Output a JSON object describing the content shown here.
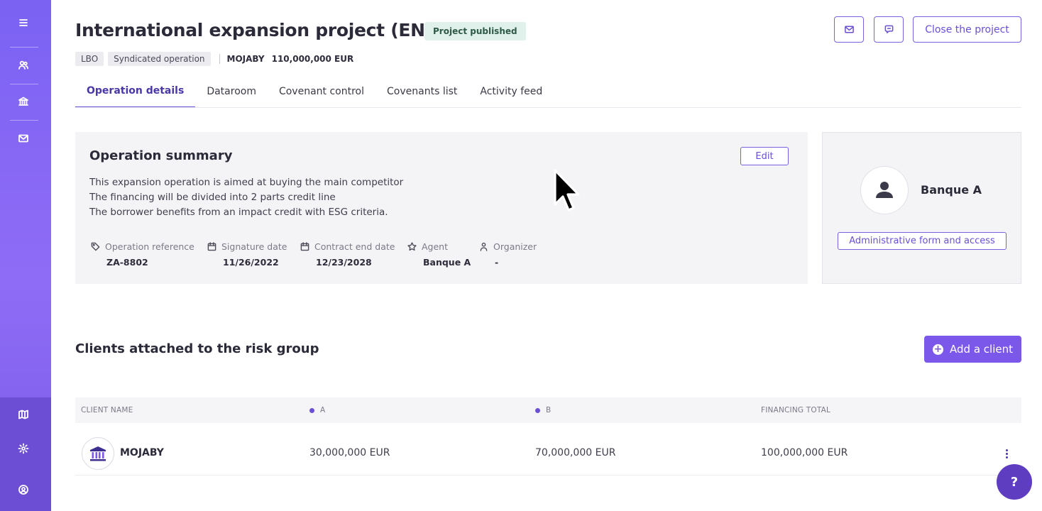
{
  "header": {
    "title": "International expansion project (EN)",
    "status": "Project published",
    "close_label": "Close the project",
    "icon_buttons": [
      "mail-icon",
      "chat-icon"
    ],
    "tags": [
      "LBO",
      "Syndicated operation"
    ],
    "borrower": "MOJABY",
    "amount": "110,000,000 EUR"
  },
  "sidebar": {
    "items": [
      "menu-icon",
      "users-icon",
      "bank-icon",
      "mail-icon"
    ],
    "bottom_items": [
      "map-icon",
      "settings-icon",
      "user-circle-icon"
    ]
  },
  "tabs": [
    {
      "label": "Operation details",
      "active": true
    },
    {
      "label": "Dataroom",
      "active": false
    },
    {
      "label": "Covenant control",
      "active": false
    },
    {
      "label": "Covenants list",
      "active": false
    },
    {
      "label": "Activity feed",
      "active": false
    }
  ],
  "summary": {
    "title": "Operation summary",
    "edit_label": "Edit",
    "lines": [
      "This expansion operation is aimed at buying the main competitor",
      "The financing will be divided into 2 parts credit line",
      "The borrower benefits from an impact credit with ESG criteria."
    ],
    "fields": [
      {
        "label": "Operation reference",
        "value": "ZA-8802",
        "icon": "tag-icon"
      },
      {
        "label": "Signature date",
        "value": "11/26/2022",
        "icon": "calendar-icon"
      },
      {
        "label": "Contract end date",
        "value": "12/23/2028",
        "icon": "calendar-icon"
      },
      {
        "label": "Agent",
        "value": "Banque A",
        "icon": "star-icon"
      },
      {
        "label": "Organizer",
        "value": "-",
        "icon": "person-icon"
      }
    ]
  },
  "agent_card": {
    "name": "Banque A",
    "admin_label": "Administrative form and access"
  },
  "clients": {
    "title": "Clients attached to the risk group",
    "add_label": "Add a client",
    "columns": [
      "CLIENT NAME",
      "A",
      "B",
      "FINANCING TOTAL"
    ],
    "rows": [
      {
        "name": "MOJABY",
        "a": "30,000,000 EUR",
        "b": "70,000,000 EUR",
        "total": "100,000,000 EUR"
      }
    ]
  },
  "help_label": "?",
  "colors": {
    "accent": "#7b58ea",
    "badge_bg": "#dff1ea",
    "sidebar": "#8f6cf6"
  }
}
